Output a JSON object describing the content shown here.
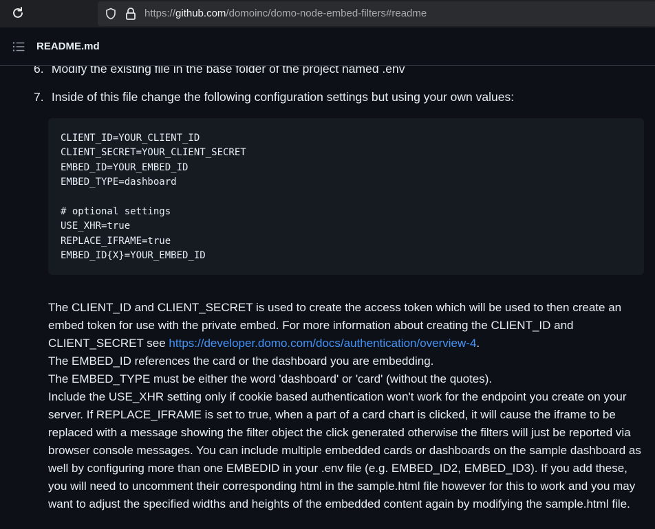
{
  "browser": {
    "url_prefix": "https://",
    "url_host": "github.com",
    "url_path": "/domoinc/domo-node-embed-filters#readme"
  },
  "readme": {
    "title": "README.md"
  },
  "steps": [
    {
      "num": "6.",
      "text": "Modify the existing file in the base folder of the project named .env"
    },
    {
      "num": "7.",
      "text": "Inside of this file change the following configuration settings but using your own values:"
    }
  ],
  "code_lines": [
    "CLIENT_ID=YOUR_CLIENT_ID",
    "CLIENT_SECRET=YOUR_CLIENT_SECRET",
    "EMBED_ID=YOUR_EMBED_ID",
    "EMBED_TYPE=dashboard",
    "",
    "# optional settings",
    "USE_XHR=true",
    "REPLACE_IFRAME=true",
    "EMBED_ID{X}=YOUR_EMBED_ID"
  ],
  "description": {
    "p1_before_link": "The CLIENT_ID and CLIENT_SECRET is used to create the access token which will be used to then create an embed token for use with the private embed. For more information about creating the CLIENT_ID and CLIENT_SECRET see ",
    "p1_link": "https://developer.domo.com/docs/authentication/overview-4",
    "p1_after_link": ".",
    "p2": "The EMBED_ID references the card or the dashboard you are embedding.",
    "p3": "The EMBED_TYPE must be either the word 'dashboard' or 'card' (without the quotes).",
    "p4": "Include the USE_XHR setting only if cookie based authentication won't work for the endpoint you create on your server. If REPLACE_IFRAME is set to true, when a part of a card chart is clicked, it will cause the iframe to be replaced with a message showing the filter object the click generated otherwise the filters will just be reported via browser console messages. You can include multiple embedded cards or dashboards on the sample dashboard as well by configuring more than one EMBEDID in your .env file (e.g. EMBED_ID2, EMBED_ID3). If you add these, you will need to uncomment their corresponding html in the sample.html file however for this to work and you may want to adjust the specified widths and heights of the embedded content again by modifying the sample.html file."
  }
}
